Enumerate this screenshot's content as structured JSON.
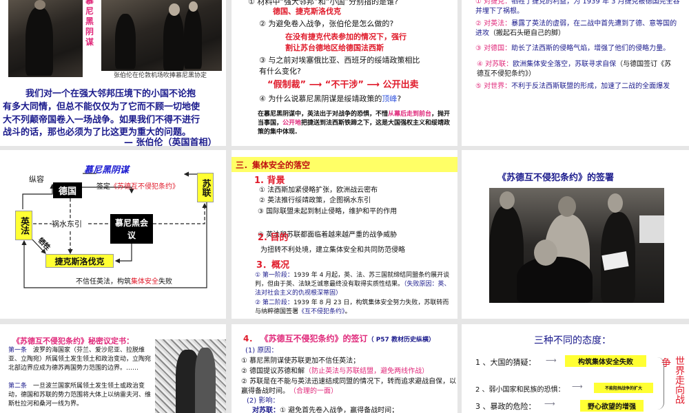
{
  "slide1": {
    "vertical_title": "慕尼黑阴谋",
    "photo_caption": "张伯伦在伦敦机场吹捧慕尼黑协定",
    "quote_lines": [
      "我们对一个在强大邻邦压境下的小国不论抱",
      "有多大同情，但总不能仅仅为了它而不顾一切地使",
      "大不列颠帝国卷入一场战争。如果我们不得不进行",
      "战斗的话，那也必须为了比这更为重大的问题。"
    ],
    "quote_author": "— 张伯伦（英国首相）"
  },
  "slide2": {
    "q1": "① 材料中“强大邻邦”和“小国”分别指的是谁?",
    "a1": "德国、捷克斯洛伐克",
    "q2": "② 为避免卷入战争，张伯伦是怎么做的?",
    "a2_lines": [
      "在没有捷克代表参加的情况下，强行",
      "割让苏台德地区给德国法西斯"
    ],
    "q3_lines": [
      "③ 与之前对埃塞俄比亚、西班牙的绥靖政策相比",
      "有什么变化?"
    ],
    "a3": [
      "“假制裁”",
      "“不干涉”",
      "公开出卖"
    ],
    "q4": "④ 为什么说慕尼黑阴谋是绥靖政策的",
    "q4_highlight": "顶峰",
    "q4_end": "?",
    "summary": {
      "p1": "在慕尼黑阴谋中，英法出于对战争的恐惧，不惜",
      "h1": "从幕后走到前台",
      "p2": "，抛开当事国，",
      "h2": "公开地",
      "p3": "把捷送到法西斯铁蹄之下，",
      "p4": "这是大国强权主义和绥靖政策的集中体现."
    }
  },
  "slide3": {
    "items": [
      {
        "label": "① 对捷克：",
        "text": "牺牲了捷克的利益，为 1939 年 3 月捷克被德国完全吞并埋下了祸根。"
      },
      {
        "label": "② 对英法：",
        "text": "暴露了英法的虚弱，在二战中首先遭到了德、意等国的进攻",
        "note": "（搬起石头砸自己的脚）"
      },
      {
        "label": "③ 对德国：",
        "text": "助长了法西斯的侵略气焰，增强了他们的侵略力量。"
      },
      {
        "label": "④ 对苏联：",
        "text": "欧洲集体安全落空，苏联寻求自保",
        "note": "（与德国签订《苏德互不侵犯条约》）"
      },
      {
        "label": "⑤ 对世界：",
        "text": "不利于反法西斯联盟的形成，加速了二战的全面爆发"
      }
    ]
  },
  "slide4": {
    "title": "慕尼黑阴谋",
    "zongrong": "纵容",
    "germany": "德国",
    "sign": "签定",
    "treaty": "《苏德互不侵犯条约》",
    "ussr": "苏联",
    "uk_fr": "英法",
    "east": "祸水东引",
    "munich": "慕尼黑会议",
    "sacrifice": "牺牲",
    "czech": "捷克斯洛伐克",
    "distrust": "不信任英法，构筑",
    "collective": "集体安全",
    "fail": "失败"
  },
  "slide5": {
    "header": "三．集体安全的落空",
    "bg_title": "1. 背景",
    "bg_items": [
      "① 法西斯加紧侵略扩张，欧洲战云密布",
      "② 英法推行绥靖政策，企图祸水东引",
      "③ 国际联盟未起到制止侵略，维护和平的作用",
      "④ 英法和苏联都面临着越来越严重的战争威胁"
    ],
    "aim_title": "2. 目的",
    "aim_text": "为扭转不利处境，建立集体安全和共同防范侵略",
    "overview_title": "3．概况",
    "stage1_label": "① 第一阶段：",
    "stage1_text": "1939 年 4 月起，英、法、苏三国就缔结同盟条约展开谈判，但由于英、法缺乏诚意最终没有取得实质性结果。",
    "stage1_reason": "（失败原因：英、法对社会主义的仇视根深蒂固）",
    "stage2_label": "② 第二阶段：",
    "stage2_text": "1939 年 8 月 23 日，构筑集体安全努力失败，苏联转而与纳粹德国签署",
    "stage2_treaty": "《互不侵犯条约》",
    "stage2_end": "。"
  },
  "slide6": {
    "title": "《苏德互不侵犯条约》的签署"
  },
  "slide7": {
    "title": "《苏德互不侵犯条约》秘密议定书：",
    "art1_label": "第一条",
    "art1_text": "波罗的海国家（芬兰、爱沙尼亚、拉脱维亚、立陶宛）所属领土发生领土和政治变动，立陶宛北部边界应成为德苏两国势力范围的边界。……",
    "art2_label": "第二条",
    "art2_text": "一旦波兰国家所属领土发生领土或政治变动，德国和苏联的势力范围将大体上以纳雷夫河、维斯杜拉河和桑河一线为界。"
  },
  "slide8": {
    "num": "4．",
    "title": "《苏德互不侵犯条约》的签订",
    "ref": "（ P57 教材历史纵横）",
    "cause_title": "(1) 原因：",
    "c1": "① 慕尼黑阴谋使苏联更加不信任英法；",
    "c2": "② 德国提议苏德和解",
    "c2_note": "（防止英法与苏联结盟，避免两线作战）",
    "c3": "② 苏联是在不能与英法迅速结成同盟的情况下，转而追求避战自保，以赢得备战时间。",
    "c3_note": "（合理的一面）",
    "effect_title": "(2) 影响：",
    "effect_label": "对苏联：",
    "e1": "① 避免首先卷入战争，赢得备战时间；"
  },
  "slide9": {
    "title": "三种不同的态度：",
    "rows": [
      {
        "label": "1 、大国的猜疑：",
        "result": "构筑集体安全失败"
      },
      {
        "label": "2 、弱小国家和民族的恐惧：",
        "result": "不能阻挡战争的扩大"
      },
      {
        "label": "3 、暴政的危险：",
        "result": "野心欲望的增强"
      }
    ],
    "conclusion_a": "争",
    "conclusion_b": "世界走向战"
  }
}
